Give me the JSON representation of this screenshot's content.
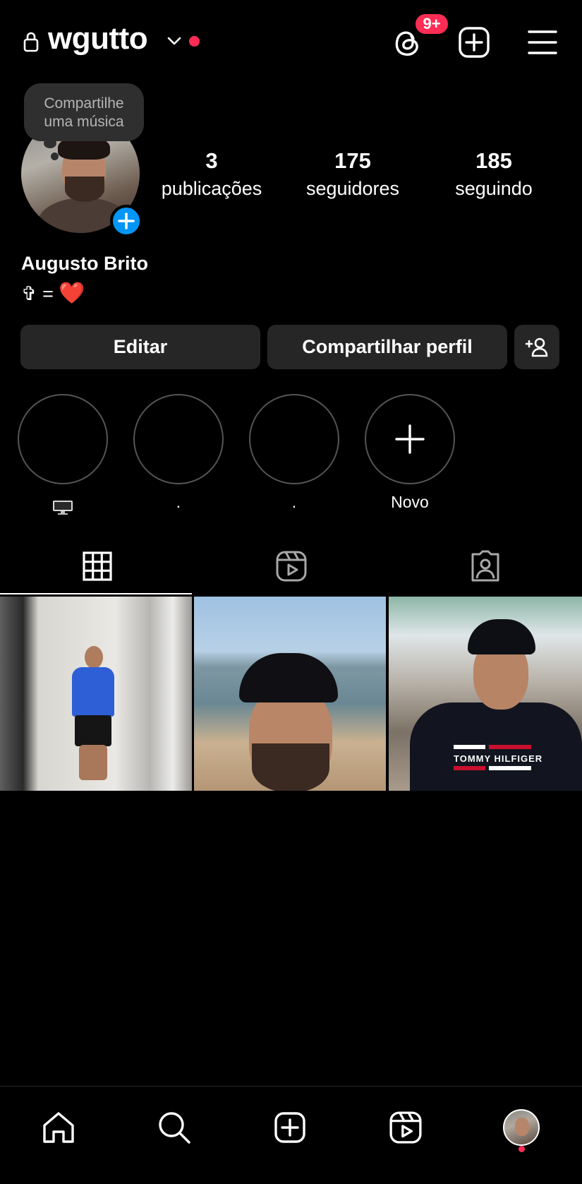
{
  "header": {
    "username": "wgutto",
    "notification_badge": "9+",
    "icons": [
      "lock-icon",
      "chevron-down-icon",
      "threads-icon",
      "add-post-icon",
      "menu-icon"
    ]
  },
  "note": {
    "text_line1": "Compartilhe",
    "text_line2": "uma música"
  },
  "stats": {
    "posts": {
      "value": "3",
      "label": "publicações"
    },
    "followers": {
      "value": "175",
      "label": "seguidores"
    },
    "following": {
      "value": "185",
      "label": "seguindo"
    }
  },
  "profile": {
    "full_name": "Augusto Brito",
    "bio_text": "✞ =",
    "bio_emoji": "❤️"
  },
  "buttons": {
    "edit": "Editar",
    "share": "Compartilhar perfil"
  },
  "highlights": [
    {
      "label": "🖥️"
    },
    {
      "label": "."
    },
    {
      "label": "."
    },
    {
      "label": "Novo"
    }
  ],
  "post3_logo": "TOMMY HILFIGER",
  "colors": {
    "accent_blue": "#0095f6",
    "badge_red": "#ff2d55",
    "button_bg": "#262626",
    "background": "#000000"
  }
}
